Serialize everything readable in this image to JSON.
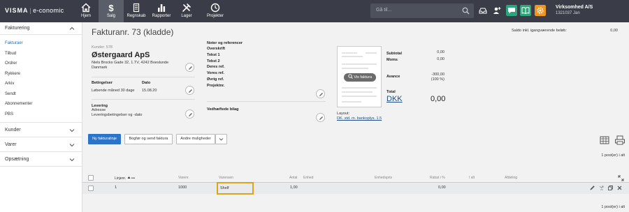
{
  "app": {
    "brand": "VISMA",
    "product": "e-conomic"
  },
  "nav": {
    "tabs": [
      {
        "label": "Hjem",
        "icon": "home-icon"
      },
      {
        "label": "Salg",
        "icon": "dollar-icon"
      },
      {
        "label": "Regnskab",
        "icon": "ledger-icon"
      },
      {
        "label": "Rapporter",
        "icon": "bar-chart-icon"
      },
      {
        "label": "Lager",
        "icon": "tools-icon"
      },
      {
        "label": "Projekter",
        "icon": "clock-icon"
      }
    ],
    "active_tab": "Salg"
  },
  "search": {
    "placeholder": "Gå til..."
  },
  "account": {
    "name": "Virksomhed A/S",
    "id": "1321037 Jan"
  },
  "colors": {
    "topbar": "#3a3d47",
    "primary": "#2c74c7",
    "highlight": "#d8a521",
    "settings": "#f0961e",
    "chat": "#2aa67a"
  },
  "sidebar": {
    "sections": [
      {
        "label": "Fakturering",
        "expanded": true,
        "items": [
          "Fakturaer",
          "Tilbud",
          "Ordrer",
          "Rykkere",
          "Arkiv",
          "Sendt",
          "Abonnementer",
          "PBS"
        ]
      },
      {
        "label": "Kunder",
        "expanded": false
      },
      {
        "label": "Varer",
        "expanded": false
      },
      {
        "label": "Opsætning",
        "expanded": false
      }
    ]
  },
  "invoice": {
    "title": "Fakturanr. 73 (kladde)",
    "saldo_label": "Saldo inkl. igangværende beløb:",
    "saldo_value": "0,00",
    "customer": {
      "number": "Kunder: 578",
      "name": "Østergaard ApS",
      "address": "Niels Brocks Gade 32, 1.TV, 4242 Boeslunde",
      "country": "Danmark"
    },
    "terms_label": "Betingelser",
    "terms_value": "Løbende måned 30 dage",
    "date_label": "Dato",
    "date_value": "15.08.20",
    "delivery_label": "Levering",
    "delivery_lines": [
      "Adresse",
      "Leveringsbetingelser og -dato"
    ],
    "notes_fields": [
      "Noter og referencer",
      "Overskrift",
      "Tekst 1",
      "Tekst 2",
      "Deres ref.",
      "Vores ref.",
      "Øvrig ref.",
      "Projektnr."
    ],
    "attachments_label": "Vedhæftede bilag",
    "preview_button": "Vis faktura",
    "layout_label": "Layout:",
    "layout_value": "DK. std. m. bankoplys. 1.5",
    "totals": {
      "subtotal_label": "Subtotal",
      "subtotal_value": "0,00",
      "moms_label": "Moms",
      "moms_value": "0,00",
      "avance_label": "Avance",
      "avance_value": "-300,00",
      "avance_pct": "(100 %)",
      "total_label": "Total",
      "currency": "DKK",
      "total_value": "0,00"
    }
  },
  "toolbar": {
    "new_line": "Ny fakturalinje",
    "book_send": "Bogfør og send faktura",
    "more": "Andre muligheder",
    "count_top": "1 post(er) i alt"
  },
  "table": {
    "columns": [
      "Linjenr.",
      "Varenr.",
      "Varenavn",
      "Antal",
      "Enhed",
      "Enhedspris",
      "Rabat i %",
      "I alt",
      "Afdeling"
    ],
    "rows": [
      {
        "linjenr": "1",
        "varenr": "1000",
        "varenavn": "Shelf",
        "antal": "1,00",
        "enhed": "",
        "enhedspris": "",
        "rabat": "0,00",
        "i_alt": "",
        "afdeling": ""
      }
    ],
    "count_bottom": "1 post(er) i alt"
  }
}
